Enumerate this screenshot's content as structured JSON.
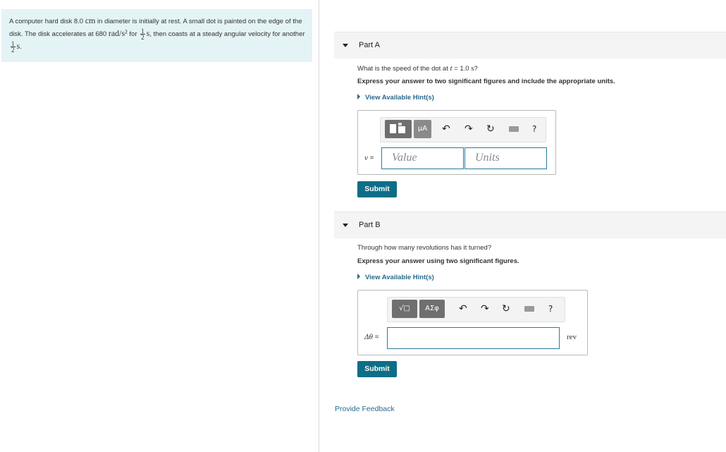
{
  "problem": {
    "t1": "A computer hard disk 8.0 ",
    "m1": "cm",
    "t2": " in diameter is initially at rest. A small dot is painted on the edge of the disk. The disk accelerates at 680 ",
    "m2": "rad/s²",
    "t3": " for ",
    "f1_num": "1",
    "f1_den": "2",
    "m3": "s",
    "t4": ", then coasts at a steady angular velocity for another ",
    "f2_num": "1",
    "f2_den": "2",
    "m4": "s",
    "t5": "."
  },
  "partA": {
    "title": "Part A",
    "q_pre": "What is the speed of the dot at ",
    "q_var": "t",
    "q_mid": " = 1.0 ",
    "q_unit": "s",
    "q_post": "?",
    "instruction": "Express your answer to two significant figures and include the appropriate units.",
    "hint": "View Available Hint(s)",
    "tb_btn2": "μA",
    "tb_undo": "↶",
    "tb_redo": "↷",
    "tb_reset": "↻",
    "tb_help": "?",
    "var": "v",
    "eq": " =",
    "value_placeholder": "Value",
    "units_placeholder": "Units",
    "submit": "Submit"
  },
  "partB": {
    "title": "Part B",
    "question": "Through how many revolutions has it turned?",
    "instruction": "Express your answer using two significant figures.",
    "hint": "View Available Hint(s)",
    "tb_btn1": "√□",
    "tb_btn2": "ΑΣφ",
    "tb_undo": "↶",
    "tb_redo": "↷",
    "tb_reset": "↻",
    "tb_help": "?",
    "var": "Δθ",
    "eq": " =",
    "unit": "rev",
    "submit": "Submit"
  },
  "feedback": "Provide Feedback",
  "colors": {
    "accent": "#0e6e87",
    "link": "#2a6a8c",
    "problem_bg": "#e4f3f5"
  },
  "icons": [
    "templates-icon",
    "units-icon",
    "undo-icon",
    "redo-icon",
    "reset-icon",
    "keyboard-icon",
    "help-icon",
    "sqrt-icon",
    "greek-icon"
  ]
}
